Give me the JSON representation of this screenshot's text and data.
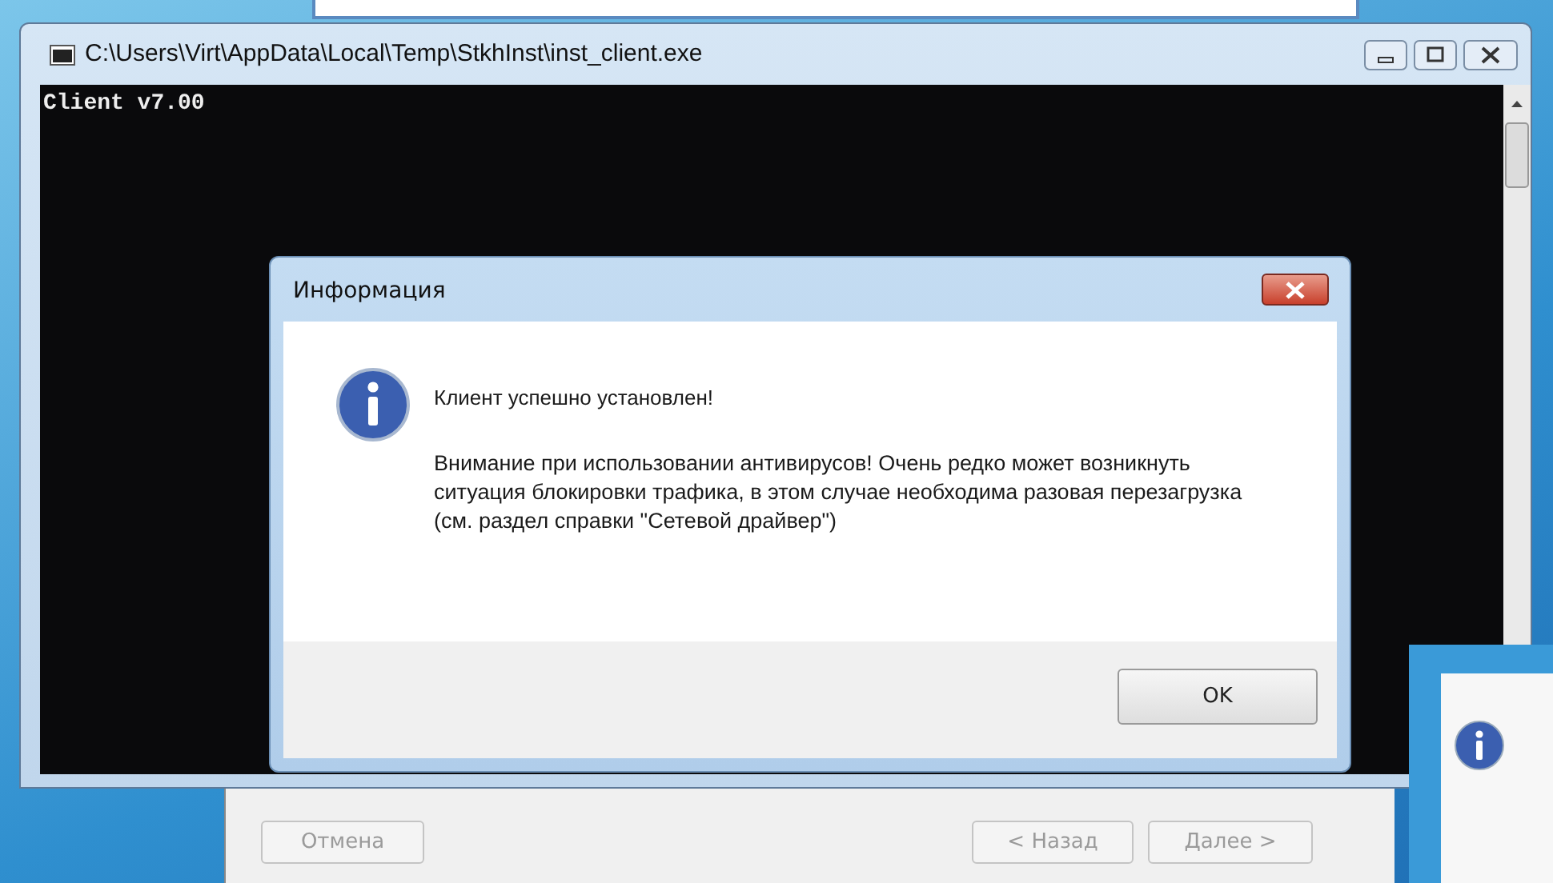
{
  "console_window": {
    "title": "C:\\Users\\Virt\\AppData\\Local\\Temp\\StkhInst\\inst_client.exe",
    "output": [
      "Client v7.00"
    ]
  },
  "dialog": {
    "title": "Информация",
    "heading": "Клиент успешно установлен!",
    "message": "Внимание при использовании антивирусов! Очень редко может возникнуть ситуация блокировки трафика, в этом случае необходима разовая перезагрузка (см. раздел справки \"Сетевой драйвер\")",
    "button": "OK"
  },
  "installer": {
    "buttons": [
      {
        "label": "Отмена",
        "disabled": true,
        "kind": "cancel"
      },
      {
        "label": "< Назад",
        "disabled": true,
        "kind": "back"
      },
      {
        "label": "Далее >",
        "disabled": true,
        "kind": "next"
      }
    ]
  }
}
